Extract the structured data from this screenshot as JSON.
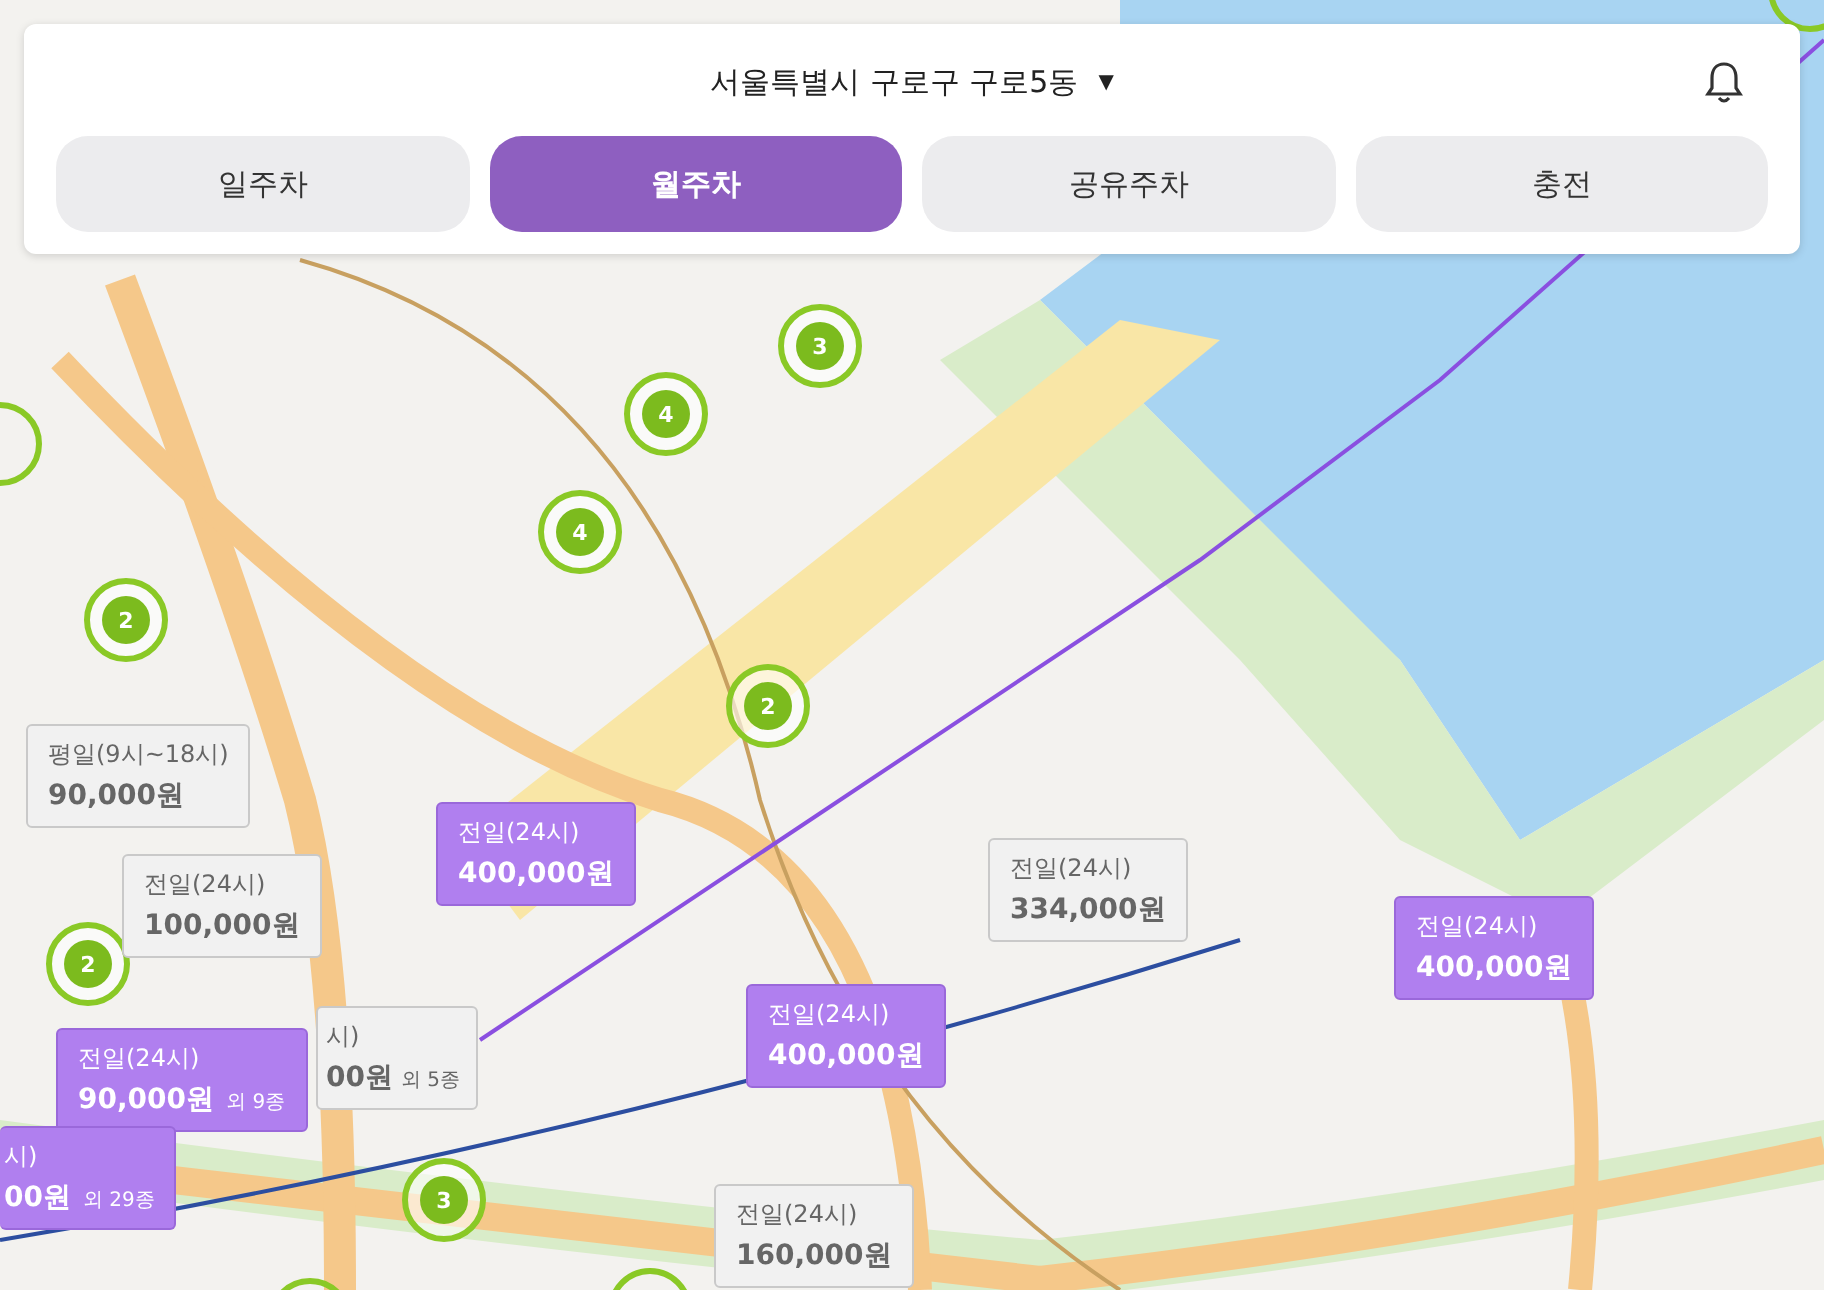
{
  "header": {
    "location": "서울특별시 구로구 구로5동",
    "caret": "▼"
  },
  "tabs": [
    {
      "label": "일주차",
      "selected": false
    },
    {
      "label": "월주차",
      "selected": true
    },
    {
      "label": "공유주차",
      "selected": false
    },
    {
      "label": "충전",
      "selected": false
    }
  ],
  "clusters": [
    {
      "count": "3"
    },
    {
      "count": "4"
    },
    {
      "count": "4"
    },
    {
      "count": "2"
    },
    {
      "count": "2"
    },
    {
      "count": "2"
    },
    {
      "count": "3"
    }
  ],
  "price_markers": [
    {
      "kind": "full",
      "highlighted": false,
      "label": "평일(9시~18시)",
      "price": "90,000원"
    },
    {
      "kind": "full",
      "highlighted": false,
      "label": "전일(24시)",
      "price": "100,000원"
    },
    {
      "kind": "full",
      "highlighted": true,
      "label": "전일(24시)",
      "price": "400,000원"
    },
    {
      "kind": "full",
      "highlighted": false,
      "label": "전일(24시)",
      "price": "334,000원"
    },
    {
      "kind": "full",
      "highlighted": true,
      "label": "전일(24시)",
      "price": "400,000원"
    },
    {
      "kind": "full",
      "highlighted": true,
      "label": "전일(24시)",
      "price": "400,000원"
    },
    {
      "kind": "partial",
      "highlighted": false,
      "label": "시)",
      "price": "00원",
      "extra": "외 5종"
    },
    {
      "kind": "full",
      "highlighted": true,
      "label": "전일(24시)",
      "price": "90,000원",
      "extra": "외 9종"
    },
    {
      "kind": "edge",
      "highlighted": true,
      "label": "시)",
      "price": "00원",
      "extra": "외 29종"
    },
    {
      "kind": "full",
      "highlighted": false,
      "label": "전일(24시)",
      "price": "160,000원"
    }
  ]
}
